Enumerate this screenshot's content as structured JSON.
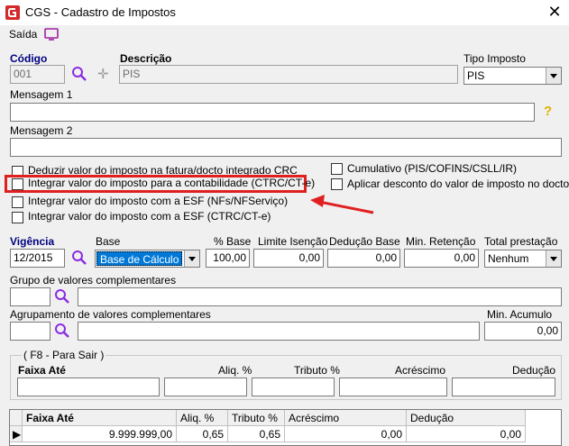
{
  "window": {
    "title": "CGS - Cadastro de Impostos",
    "close": "✕"
  },
  "menu": {
    "saida": "Saída"
  },
  "codigo": {
    "label": "Código",
    "value": "001"
  },
  "descricao": {
    "label": "Descrição",
    "value": "PIS"
  },
  "tipo_imposto": {
    "label": "Tipo Imposto",
    "value": "PIS"
  },
  "mensagem1": {
    "label": "Mensagem 1",
    "value": ""
  },
  "mensagem2": {
    "label": "Mensagem 2",
    "value": ""
  },
  "help": "?",
  "checkboxes": {
    "deduzir": "Deduzir valor do imposto na fatura/docto integrado CRC",
    "integrar_contab": "Integrar valor do imposto para a contabilidade (CTRC/CT-e)",
    "integrar_esf_nf": "Integrar valor do imposto com a ESF (NFs/NFServiço)",
    "integrar_esf_ctrc": "Integrar valor do imposto com a ESF (CTRC/CT-e)",
    "cumulativo": "Cumulativo (PIS/COFINS/CSLL/IR)",
    "aplicar_desconto": "Aplicar desconto do valor de imposto no docto"
  },
  "vigencia": {
    "label": "Vigência",
    "value": "12/2015"
  },
  "base": {
    "label": "Base",
    "value": "Base de Cálculo"
  },
  "pct_base": {
    "label": "% Base",
    "value": "100,00"
  },
  "limite_isencao": {
    "label": "Limite Isenção",
    "value": "0,00"
  },
  "deducao_base": {
    "label": "Dedução Base",
    "value": "0,00"
  },
  "min_retencao": {
    "label": "Min. Retenção",
    "value": "0,00"
  },
  "total_prestacao": {
    "label": "Total prestação",
    "value": "Nenhum"
  },
  "grupo_valores": {
    "label": "Grupo de valores complementares"
  },
  "agrupamento": {
    "label": "Agrupamento de valores complementares"
  },
  "min_acumulo": {
    "label": "Min. Acumulo",
    "value": "0,00"
  },
  "faixa_group": {
    "title": "( F8 - Para Sair )",
    "headers": [
      "Faixa Até",
      "Aliq. %",
      "Tributo %",
      "Acréscimo",
      "Dedução"
    ]
  },
  "grid": {
    "columns": [
      "Faixa Até",
      "Aliq. %",
      "Tributo %",
      "Acréscimo",
      "Dedução"
    ],
    "rows": [
      [
        "9.999.999,00",
        "0,65",
        "0,65",
        "0,00",
        "0,00"
      ]
    ]
  },
  "colors": {
    "highlight": "#e02020",
    "accent": "#000080",
    "selection": "#0078d7"
  }
}
